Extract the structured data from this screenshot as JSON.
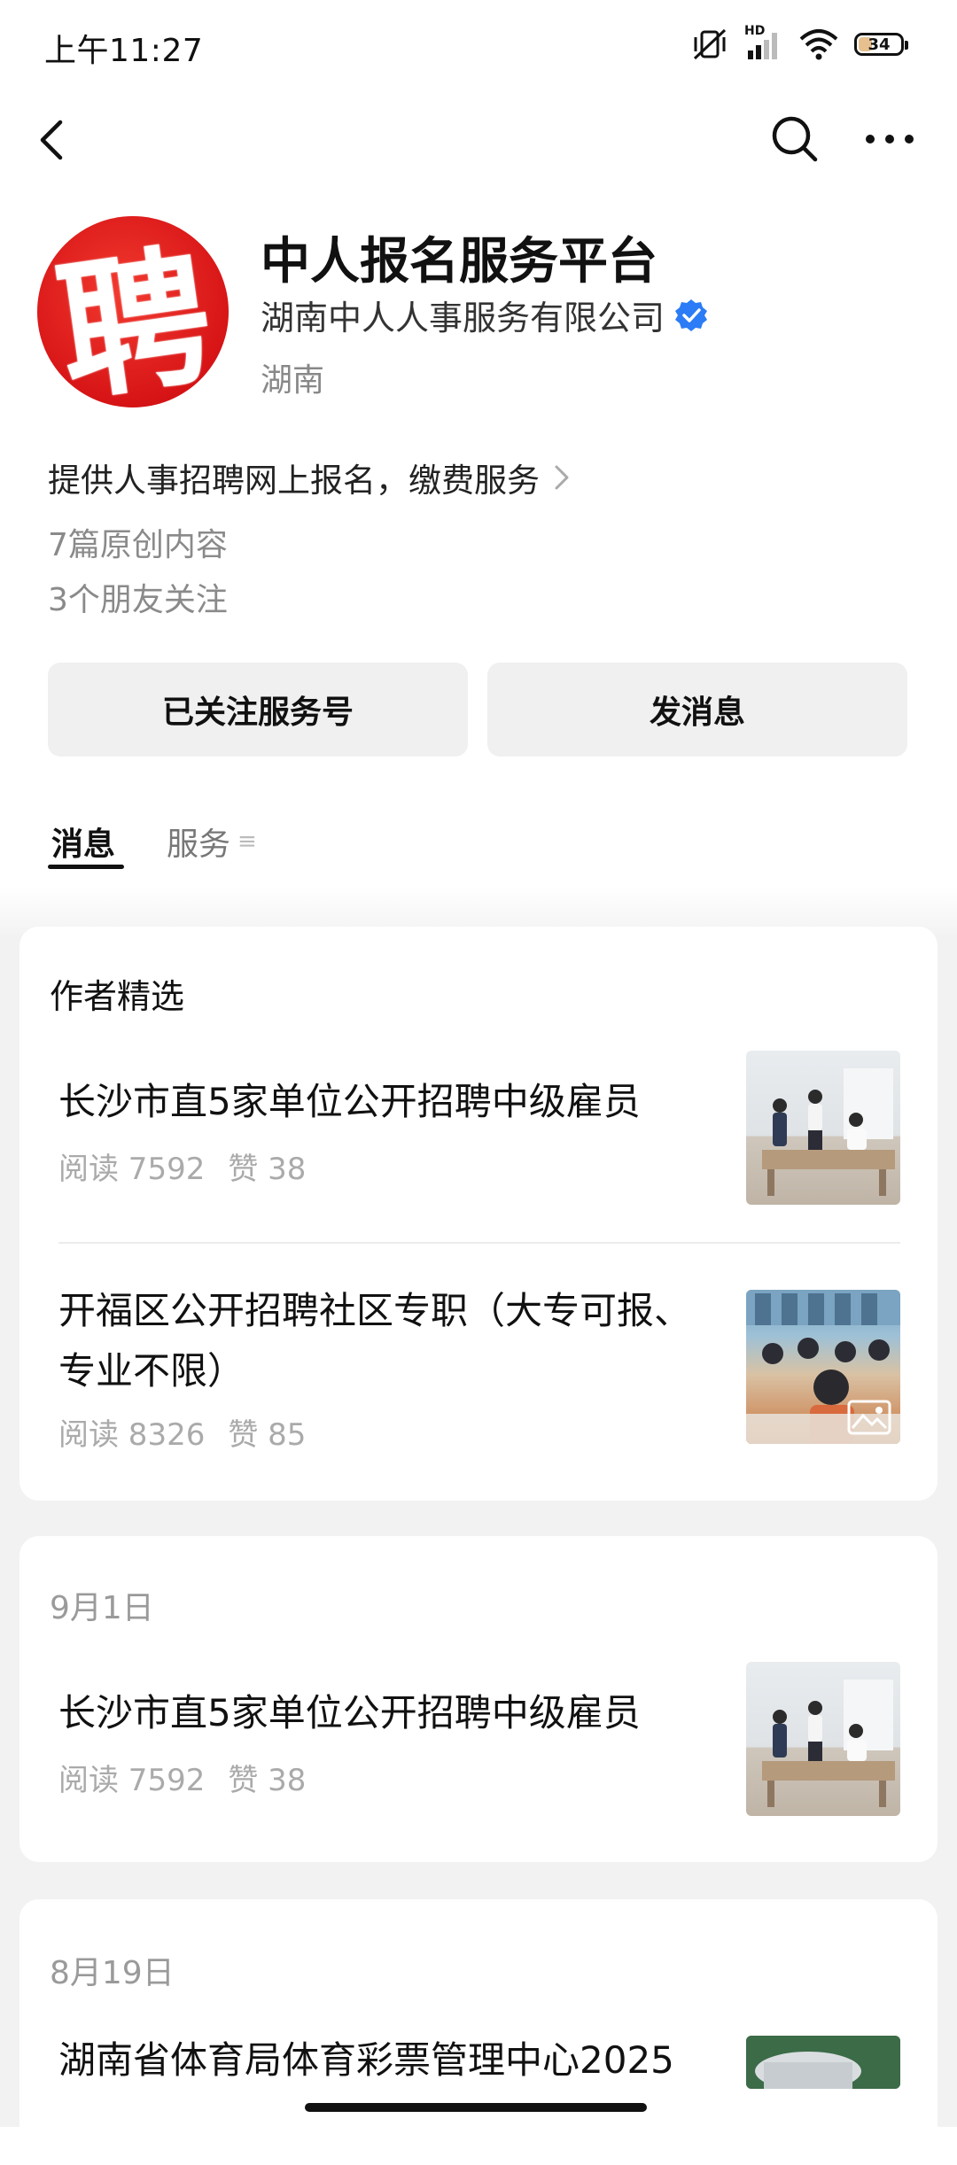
{
  "status_bar": {
    "time": "上午11:27",
    "network": "HD",
    "battery": "34"
  },
  "nav": {
    "back_icon": "chevron-left-icon",
    "search_icon": "search-icon",
    "more_icon": "more-horizontal-icon"
  },
  "profile": {
    "name": "中人报名服务平台",
    "company": "湖南中人人事服务有限公司",
    "region": "湖南",
    "avatar_char": "聘",
    "description": "提供人事招聘网上报名，缴费服务",
    "original_count": "7篇原创内容",
    "friends_follow": "3个朋友关注"
  },
  "actions": {
    "follow_label": "已关注服务号",
    "message_label": "发消息"
  },
  "tabs": {
    "messages": "消息",
    "services": "服务",
    "services_icon": "≡"
  },
  "feed": {
    "featured": {
      "title": "作者精选",
      "articles": [
        {
          "title": "长沙市直5家单位公开招聘中级雇员",
          "reads": "阅读 7592",
          "likes": "赞 38"
        },
        {
          "title": "开福区公开招聘社区专职（大专可报、专业不限）",
          "reads": "阅读 8326",
          "likes": "赞 85"
        }
      ]
    },
    "groups": [
      {
        "date": "9月1日",
        "article": {
          "title": "长沙市直5家单位公开招聘中级雇员",
          "reads": "阅读 7592",
          "likes": "赞 38"
        }
      },
      {
        "date": "8月19日",
        "article": {
          "title": "湖南省体育局体育彩票管理中心2025"
        }
      }
    ]
  },
  "colors": {
    "accent": "#111111",
    "verified": "#2b7cf6",
    "avatar_red": "#d71416",
    "meta_gray": "#aaaaaa",
    "feed_bg": "#f2f2f2"
  }
}
